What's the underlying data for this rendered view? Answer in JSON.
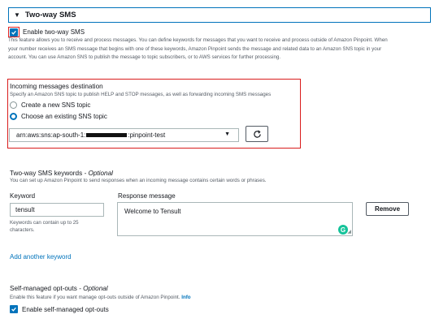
{
  "section": {
    "caret": "▼",
    "title": "Two-way SMS"
  },
  "enable_two_way": {
    "label": "Enable two-way SMS",
    "checked": true,
    "description_lines": [
      "This feature allows you to receive and process messages. You can define keywords for messages that you want to receive and process outside of Amazon Pinpoint. When",
      "your number receives an SMS message that begins with one of these keywords, Amazon Pinpoint sends the message and related data to an Amazon SNS topic in your",
      "account. You can use Amazon SNS to publish the message to topic subscribers, or to AWS services for further processing."
    ]
  },
  "incoming_destination": {
    "title": "Incoming messages destination",
    "description": "Specify an Amazon SNS topic to publish HELP and STOP messages, as well as forwarding incoming SMS messages",
    "options": [
      {
        "label": "Create a new SNS topic",
        "selected": false
      },
      {
        "label": "Choose an existing SNS topic",
        "selected": true
      }
    ],
    "topic_prefix": "arn:aws:sns:ap-south-1:",
    "topic_suffix": ":pinpoint-test",
    "dropdown_icon": "caret-down-icon",
    "refresh_icon": "refresh-icon"
  },
  "keywords": {
    "title": "Two-way SMS keywords",
    "optional": " - Optional",
    "description": "You can set up Amazon Pinpoint to send responses when an incoming message contains certain words or phrases.",
    "keyword_label": "Keyword",
    "response_label": "Response message",
    "keyword_value": "tensult",
    "response_value": "Welcome to Tensult",
    "constraint_line1": "Keywords can contain up to 25",
    "constraint_line2": "characters.",
    "remove_label": "Remove",
    "grammarly_letter": "G",
    "add_link": "Add another keyword"
  },
  "opt_outs": {
    "title": "Self-managed opt-outs",
    "optional": " - Optional",
    "description": "Enable this feature if you want manage opt-outs outside of Amazon Pinpoint.",
    "info_link": "Info",
    "checkbox_label": "Enable self-managed opt-outs",
    "checked": true
  },
  "colors": {
    "accent": "#0073bb",
    "highlight": "#d91c1c",
    "grammarly": "#15c39a"
  }
}
